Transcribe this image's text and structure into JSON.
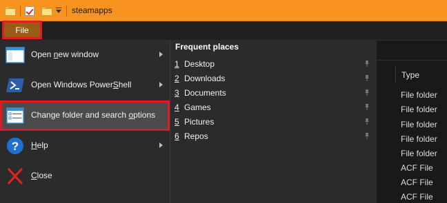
{
  "window": {
    "title": "steamapps"
  },
  "ribbon": {
    "file_tab": "File"
  },
  "menu": {
    "items": [
      {
        "pre": "Open ",
        "key": "n",
        "post": "ew window",
        "icon": "new-window-icon",
        "has_submenu": true
      },
      {
        "pre": "Open Windows Power",
        "key": "S",
        "post": "hell",
        "icon": "powershell-icon",
        "has_submenu": true
      },
      {
        "pre": "Change folder and search ",
        "key": "o",
        "post": "ptions",
        "icon": "folder-options-icon",
        "has_submenu": false,
        "highlighted": true
      },
      {
        "pre": "",
        "key": "H",
        "post": "elp",
        "icon": "help-icon",
        "has_submenu": true
      },
      {
        "pre": "",
        "key": "C",
        "post": "lose",
        "icon": "close-icon",
        "has_submenu": false
      }
    ]
  },
  "frequent": {
    "title": "Frequent places",
    "items": [
      {
        "num": "1",
        "name": "Desktop"
      },
      {
        "num": "2",
        "name": "Downloads"
      },
      {
        "num": "3",
        "name": "Documents"
      },
      {
        "num": "4",
        "name": "Games"
      },
      {
        "num": "5",
        "name": "Pictures"
      },
      {
        "num": "6",
        "name": "Repos"
      }
    ]
  },
  "file_list": {
    "column_type": "Type",
    "types": [
      "File folder",
      "File folder",
      "File folder",
      "File folder",
      "File folder",
      "ACF File",
      "ACF File",
      "ACF File"
    ]
  },
  "colors": {
    "titlebar": "#f7931e",
    "menu_bg": "#2b2b2b",
    "highlight": "#4b4b4b",
    "annotation": "#e01b24"
  }
}
